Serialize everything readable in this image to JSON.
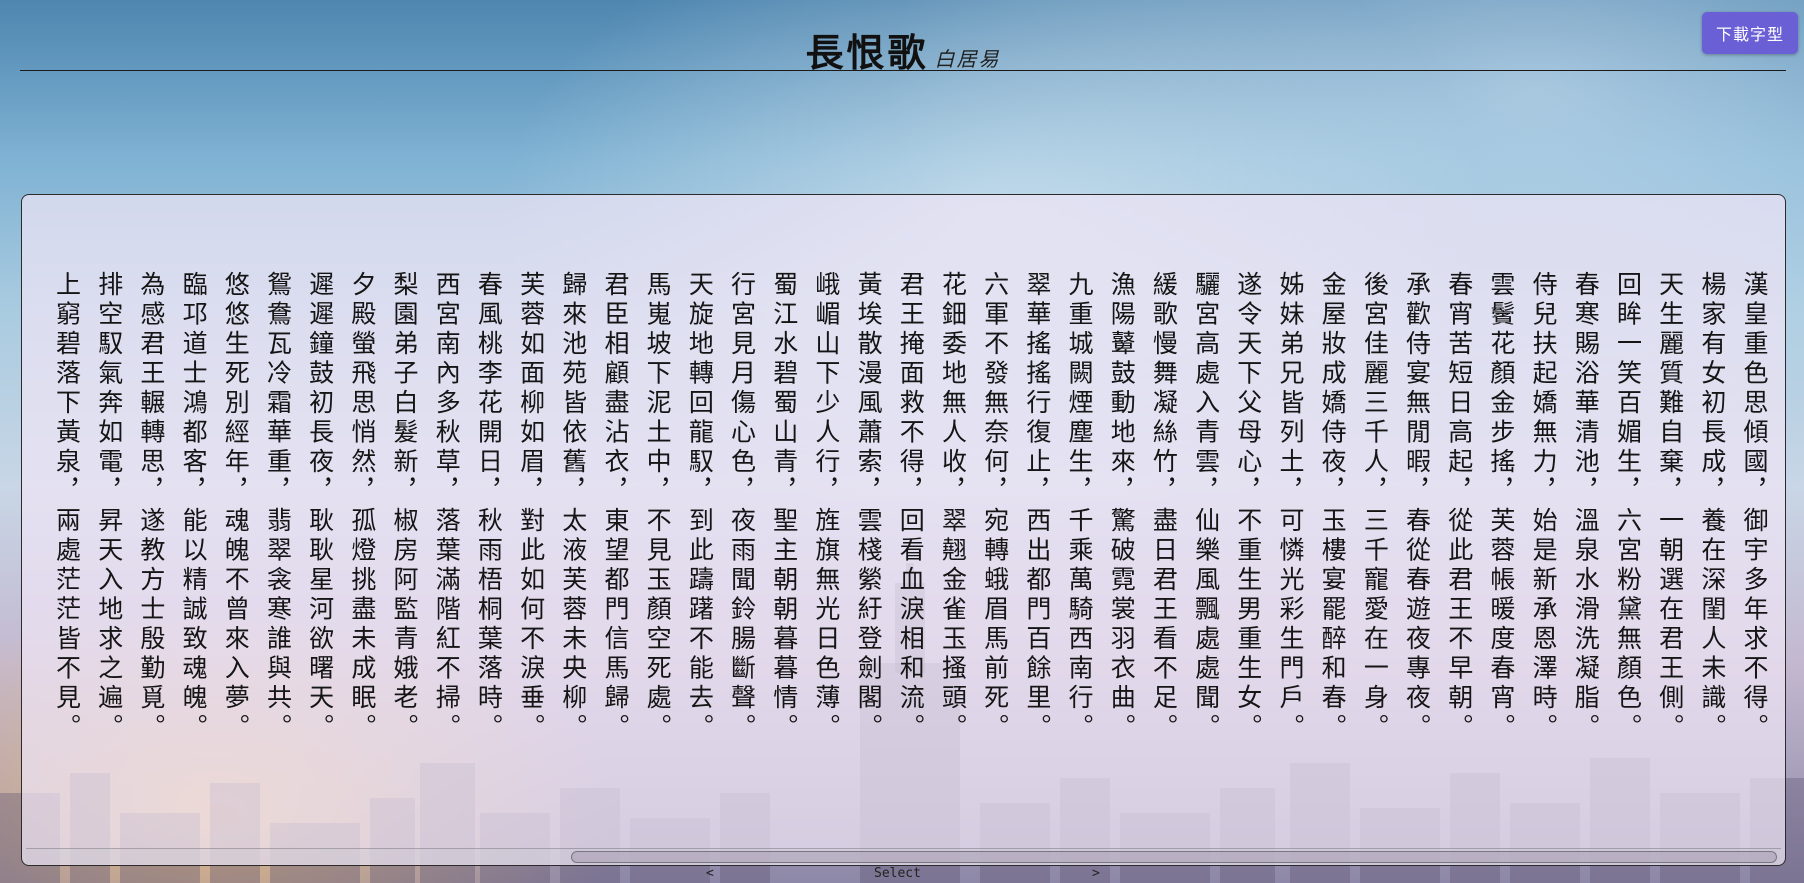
{
  "header": {
    "title": "長恨歌",
    "author": "白居易",
    "download_label": "下載字型"
  },
  "poem": {
    "columns": [
      "漢皇重色思傾國，御宇多年求不得。",
      "楊家有女初長成，養在深閨人未識。",
      "天生麗質難自棄，一朝選在君王側。",
      "回眸一笑百媚生，六宮粉黛無顏色。",
      "春寒賜浴華清池，溫泉水滑洗凝脂。",
      "侍兒扶起嬌無力，始是新承恩澤時。",
      "雲鬢花顏金步搖，芙蓉帳暖度春宵。",
      "春宵苦短日高起，從此君王不早朝。",
      "承歡侍宴無閒暇，春從春遊夜專夜。",
      "後宮佳麗三千人，三千寵愛在一身。",
      "金屋妝成嬌侍夜，玉樓宴罷醉和春。",
      "姊妹弟兄皆列土，可憐光彩生門戶。",
      "遂令天下父母心，不重生男重生女。",
      "驪宮高處入青雲，仙樂風飄處處聞。",
      "緩歌慢舞凝絲竹，盡日君王看不足。",
      "漁陽鼙鼓動地來，驚破霓裳羽衣曲。",
      "九重城闕煙塵生，千乘萬騎西南行。",
      "翠華搖搖行復止，西出都門百餘里。",
      "六軍不發無奈何，宛轉蛾眉馬前死。",
      "花鈿委地無人收，翠翹金雀玉搔頭。",
      "君王掩面救不得，回看血淚相和流。",
      "黃埃散漫風蕭索，雲棧縈紆登劍閣。",
      "峨嵋山下少人行，旌旗無光日色薄。",
      "蜀江水碧蜀山青，聖主朝朝暮暮情。",
      "行宮見月傷心色，夜雨聞鈴腸斷聲。",
      "天旋地轉回龍馭，到此躊躇不能去。",
      "馬嵬坡下泥土中，不見玉顏空死處。",
      "君臣相顧盡沾衣，東望都門信馬歸。",
      "歸來池苑皆依舊，太液芙蓉未央柳。",
      "芙蓉如面柳如眉，對此如何不淚垂。",
      "春風桃李花開日，秋雨梧桐葉落時。",
      "西宮南內多秋草，落葉滿階紅不掃。",
      "梨園弟子白髮新，椒房阿監青娥老。",
      "夕殿螢飛思悄然，孤燈挑盡未成眠。",
      "遲遲鐘鼓初長夜，耿耿星河欲曙天。",
      "鴛鴦瓦冷霜華重，翡翠衾寒誰與共。",
      "悠悠生死別經年，魂魄不曾來入夢。",
      "臨邛道士鴻都客，能以精誠致魂魄。",
      "為感君王輾轉思，遂教方士殷勤覓。",
      "排空馭氣奔如電，昇天入地求之遍。",
      "上窮碧落下黃泉，兩處茫茫皆不見。"
    ]
  },
  "pager": {
    "prev_label": "<",
    "select_label": "Select",
    "next_label": ">"
  }
}
